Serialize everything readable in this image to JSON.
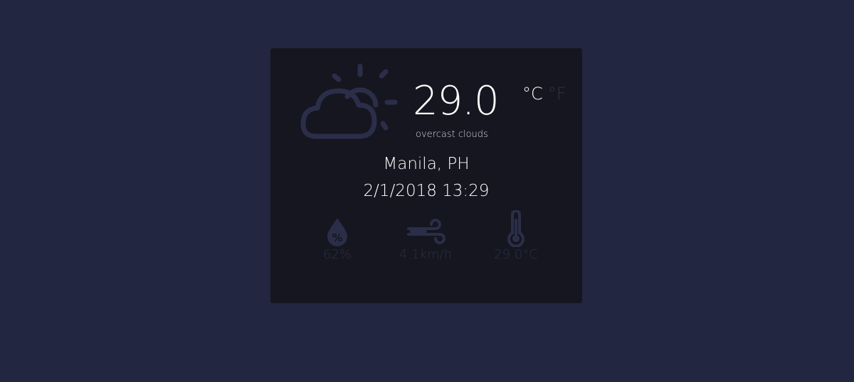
{
  "weather": {
    "temperature": "29.0",
    "description": "overcast clouds",
    "unit_celsius": "°C",
    "unit_fahrenheit": "°F",
    "location": "Manila, PH",
    "datetime": "2/1/2018 13:29"
  },
  "stats": {
    "humidity": "62%",
    "wind": "4.1km/h",
    "feels_like": "29.0°C"
  },
  "icons": {
    "main": "partly-cloudy-icon",
    "humidity": "humidity-drop-icon",
    "wind": "wind-icon",
    "temperature": "thermometer-icon"
  },
  "colors": {
    "background": "#232640",
    "card": "#15161f",
    "text": "#ffffff",
    "muted": "#2c2f46",
    "icon": "#2b2e48"
  }
}
